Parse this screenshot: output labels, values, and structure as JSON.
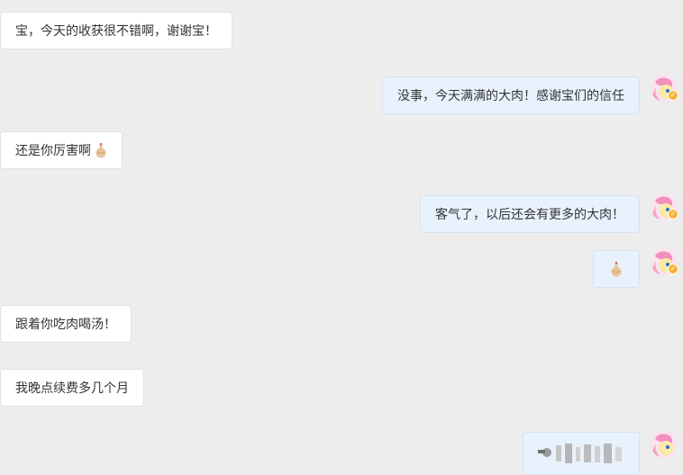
{
  "messages": [
    {
      "side": "left",
      "text": "宝，今天的收获很不错啊，谢谢宝！"
    },
    {
      "side": "right",
      "text": "没事，今天满满的大肉！感谢宝们的信任"
    },
    {
      "side": "left",
      "text": "还是你厉害啊",
      "emoji": "ok-hand-emoji"
    },
    {
      "side": "right",
      "text": "客气了，以后还会有更多的大肉！"
    },
    {
      "side": "right",
      "emoji": "ok-hand-emoji"
    },
    {
      "side": "left",
      "text": "跟着你吃肉喝汤！"
    },
    {
      "side": "left",
      "text": "我晚点续费多几个月"
    }
  ],
  "avatar": {
    "icon": "pony-avatar-icon",
    "badge_icon": "verified-badge-icon"
  },
  "colors": {
    "background": "#ededed",
    "incoming_bubble": "#ffffff",
    "outgoing_bubble": "#e8f2fd",
    "badge": "#f6b53a"
  }
}
